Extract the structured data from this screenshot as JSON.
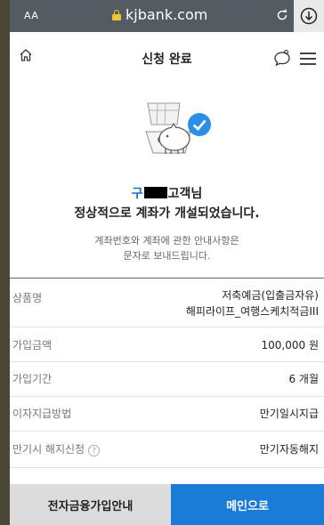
{
  "browser": {
    "text_size_label": "AA",
    "url": "kjbank.com"
  },
  "header": {
    "title": "신청 완료"
  },
  "message": {
    "name_prefix": "구",
    "name_suffix": "고객님",
    "headline": "정상적으로 계좌가 개설되었습니다.",
    "notice_line1": "계좌번호와 계좌에 관한 안내사항은",
    "notice_line2": "문자로 보내드립니다."
  },
  "details": [
    {
      "label": "상품명",
      "value_line1": "저축예금(입출금자유)",
      "value_line2": "해피라이프_여행스케치적금III"
    },
    {
      "label": "가입금액",
      "value": "100,000 원"
    },
    {
      "label": "가입기간",
      "value": "6 개월"
    },
    {
      "label": "이자지급방법",
      "value": "만기일시지급"
    },
    {
      "label": "만기시 해지신청",
      "value": "만기자동해지",
      "help": "?"
    }
  ],
  "buttons": {
    "guide": "전자금융가입안내",
    "main": "메인으로"
  },
  "colors": {
    "accent": "#1a7cd6",
    "name_highlight": "#1a73c9",
    "browser_bar": "#555b63"
  }
}
